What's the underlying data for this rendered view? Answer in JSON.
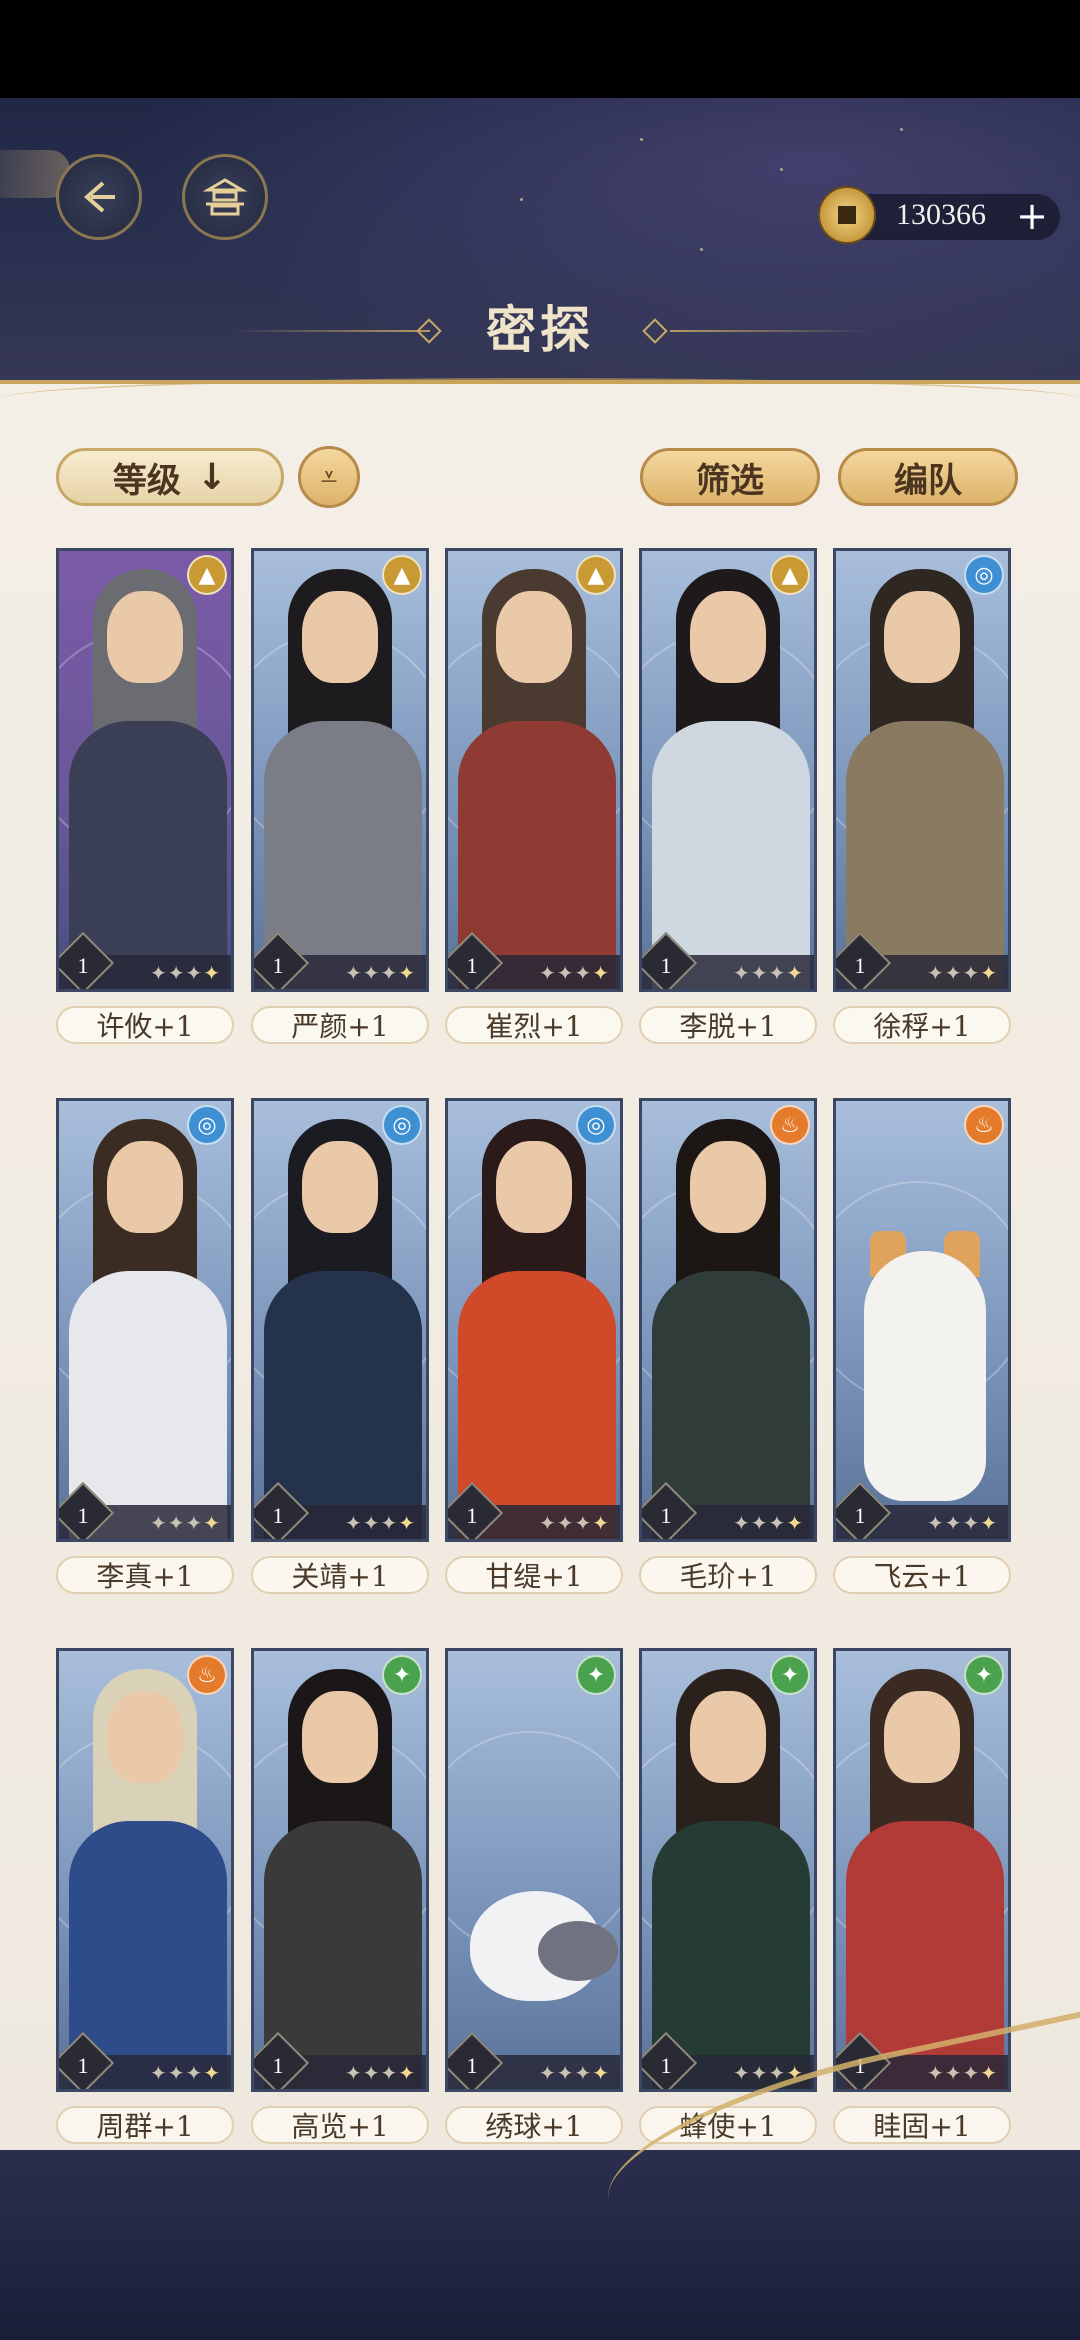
{
  "header": {
    "title": "密探",
    "currency_value": "130366",
    "plus_label": "+"
  },
  "toolbar": {
    "sort_label": "等级",
    "sort_arrow": "↓",
    "toggle_symbol": "⩡",
    "filter_label": "筛选",
    "team_label": "编队"
  },
  "characters": [
    {
      "name": "许攸+1",
      "level": "1",
      "element": "earth",
      "element_glyph": "▲"
    },
    {
      "name": "严颜+1",
      "level": "1",
      "element": "earth",
      "element_glyph": "▲"
    },
    {
      "name": "崔烈+1",
      "level": "1",
      "element": "earth",
      "element_glyph": "▲"
    },
    {
      "name": "李脱+1",
      "level": "1",
      "element": "earth",
      "element_glyph": "▲"
    },
    {
      "name": "徐稃+1",
      "level": "1",
      "element": "water",
      "element_glyph": "◎"
    },
    {
      "name": "李真+1",
      "level": "1",
      "element": "water",
      "element_glyph": "◎"
    },
    {
      "name": "关靖+1",
      "level": "1",
      "element": "water",
      "element_glyph": "◎"
    },
    {
      "name": "甘缇+1",
      "level": "1",
      "element": "water",
      "element_glyph": "◎"
    },
    {
      "name": "毛玠+1",
      "level": "1",
      "element": "fire",
      "element_glyph": "♨"
    },
    {
      "name": "飞云+1",
      "level": "1",
      "element": "fire",
      "element_glyph": "♨"
    },
    {
      "name": "周群+1",
      "level": "1",
      "element": "fire",
      "element_glyph": "♨"
    },
    {
      "name": "高览+1",
      "level": "1",
      "element": "wood",
      "element_glyph": "✦"
    },
    {
      "name": "绣球+1",
      "level": "1",
      "element": "wood",
      "element_glyph": "✦"
    },
    {
      "name": "蜂使+1",
      "level": "1",
      "element": "wood",
      "element_glyph": "✦"
    },
    {
      "name": "眭固+1",
      "level": "1",
      "element": "wood",
      "element_glyph": "✦"
    }
  ],
  "stars_display": "✦✦✦",
  "star_lit": "✦",
  "colors": {
    "earth": "#c99a33",
    "water": "#3f8fd3",
    "fire": "#e37b2b",
    "wood": "#4aa24f",
    "gold_accent": "#c9a55b"
  }
}
